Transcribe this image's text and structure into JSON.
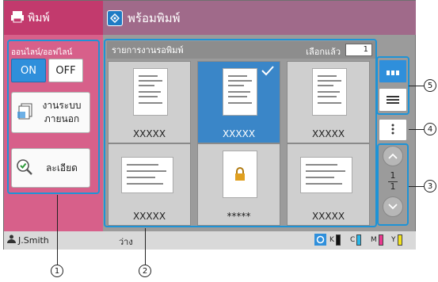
{
  "left_header": {
    "title": "พิมพ์"
  },
  "main_header": {
    "title": "พร้อมพิมพ์"
  },
  "left_panel": {
    "online_label": "ออนไลน์/ออฟไลน์",
    "on_label": "ON",
    "off_label": "OFF",
    "external_line1": "งานระบบ",
    "external_line2": "ภายนอก",
    "detail_label": "ละเอียด"
  },
  "list": {
    "title": "รายการงานรอพิมพ์",
    "selected_label": "เลือกแล้ว",
    "selected_count": "1",
    "jobs": [
      {
        "label": "XXXXX",
        "selected": false
      },
      {
        "label": "XXXXX",
        "selected": true
      },
      {
        "label": "XXXXX",
        "selected": false
      },
      {
        "label": "XXXXX",
        "selected": false
      },
      {
        "label": "*****",
        "selected": false,
        "locked": true
      },
      {
        "label": "XXXXX",
        "selected": false
      }
    ]
  },
  "pager": {
    "current": "1",
    "total": "1"
  },
  "status": {
    "user": "J.Smith",
    "state": "ว่าง",
    "ink": [
      "K",
      "C",
      "M",
      "Y"
    ]
  },
  "callouts": [
    "1",
    "2",
    "3",
    "4",
    "5"
  ],
  "colors": {
    "accent": "#c23a6d",
    "header": "#a06a8a",
    "selection": "#3a86c8",
    "callout": "#1e93d6"
  }
}
